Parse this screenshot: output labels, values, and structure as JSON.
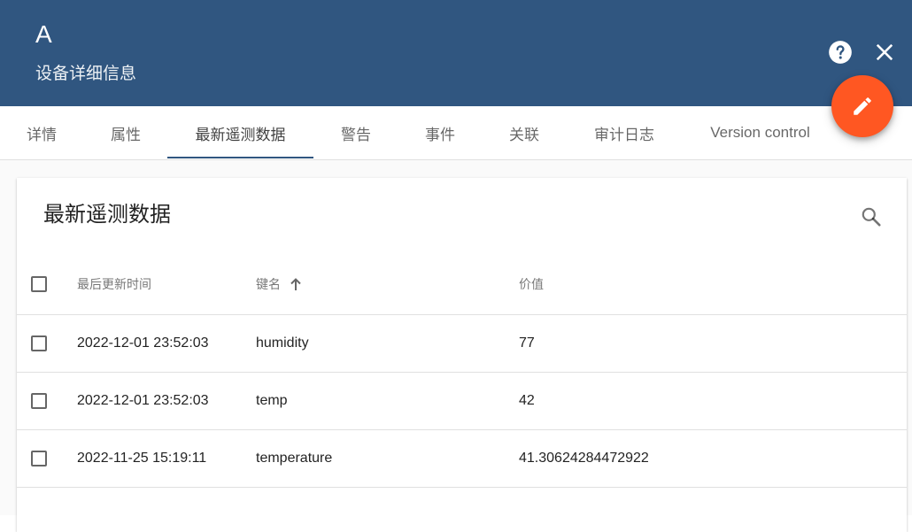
{
  "header": {
    "title": "A",
    "subtitle": "设备详细信息",
    "background_color": "#305680",
    "help_icon": "help-circle-icon",
    "close_icon": "close-icon"
  },
  "fab": {
    "icon": "edit-pencil-icon",
    "color": "#ff5722"
  },
  "tabs": [
    {
      "label": "详情"
    },
    {
      "label": "属性"
    },
    {
      "label": "最新遥测数据",
      "active": true
    },
    {
      "label": "警告"
    },
    {
      "label": "事件"
    },
    {
      "label": "关联"
    },
    {
      "label": "审计日志"
    },
    {
      "label": "Version control"
    }
  ],
  "panel": {
    "title": "最新遥测数据",
    "search_icon": "search-icon",
    "columns": {
      "last_update": "最后更新时间",
      "key": "键名",
      "key_sort": "ascending",
      "value": "价值"
    },
    "rows": [
      {
        "time": "2022-12-01 23:52:03",
        "key": "humidity",
        "value": "77"
      },
      {
        "time": "2022-12-01 23:52:03",
        "key": "temp",
        "value": "42"
      },
      {
        "time": "2022-11-25 15:19:11",
        "key": "temperature",
        "value": "41.30624284472922"
      }
    ]
  }
}
